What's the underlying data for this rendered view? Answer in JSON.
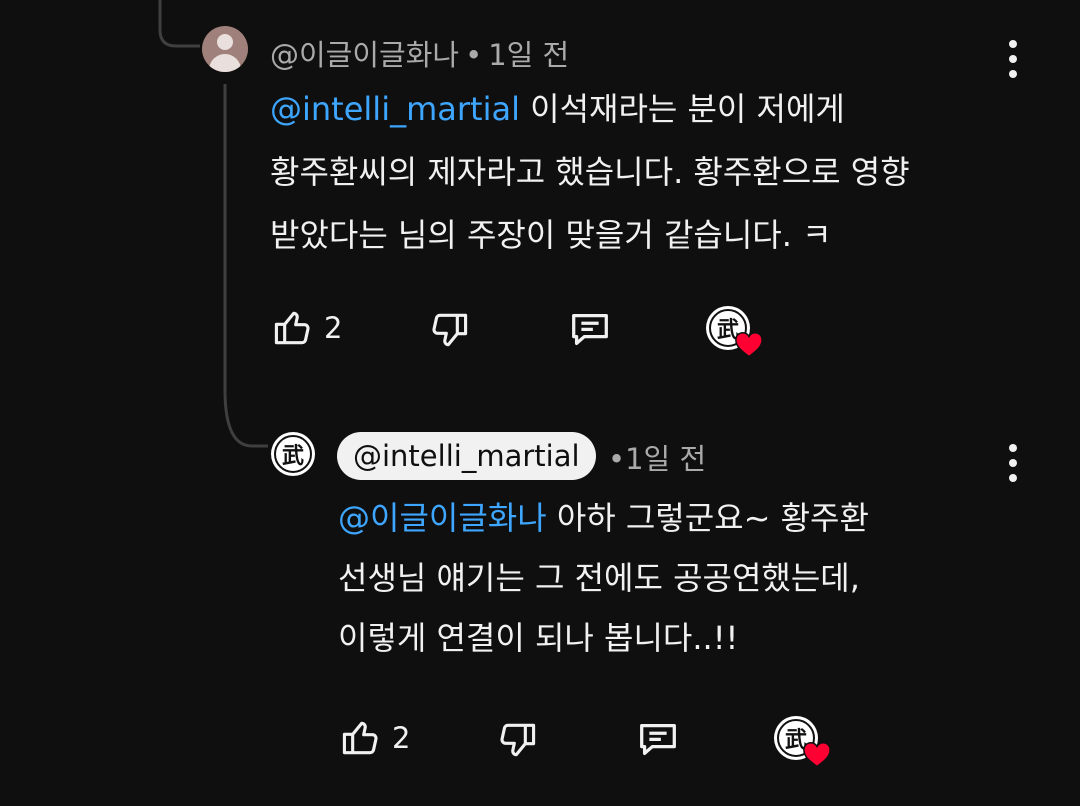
{
  "comment1": {
    "author": "@이글이글화나",
    "time": "1일 전",
    "mention": "@intelli_martial",
    "text_line1": " 이석재라는 분이 저에게",
    "text_line2": "황주환씨의 제자라고 했습니다. 황주환으로 영향",
    "text_line3": "받았다는 님의 주장이 맞을거 같습니다. ㅋ",
    "like_count": "2"
  },
  "comment2": {
    "author": "@intelli_martial",
    "time": "1일 전",
    "mention": "@이글이글화나",
    "text_line1": " 아하 그렇군요~ 황주환",
    "text_line2": "선생님 얘기는 그 전에도 공공연했는데,",
    "text_line3": "이렇게 연결이 되나 봅니다..!!",
    "like_count": "2"
  },
  "separator": "•",
  "creator_glyph": "武",
  "colors": {
    "background": "#0f0f0f",
    "mention": "#3ea6ff",
    "heart": "#ff0033",
    "meta": "#aaaaaa"
  },
  "icons": [
    "like-icon",
    "dislike-icon",
    "reply-icon",
    "more-vert-icon",
    "creator-heart-icon"
  ]
}
